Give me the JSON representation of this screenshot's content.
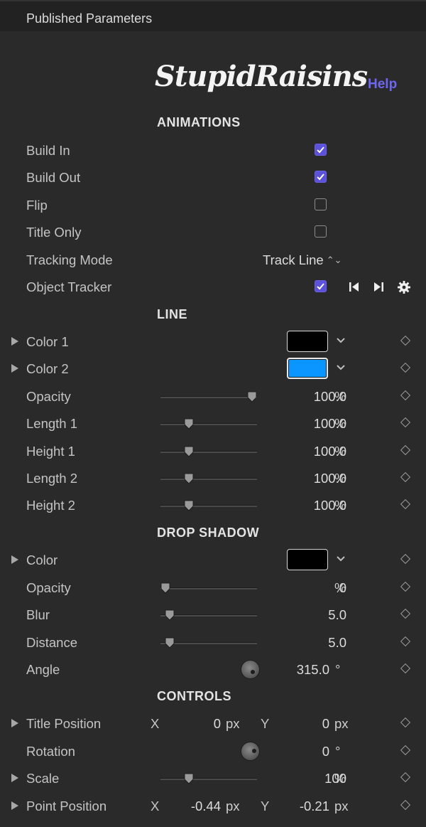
{
  "window": {
    "title": "Published Parameters"
  },
  "header": {
    "logo_text": "StupidRaisins",
    "help_label": "Help"
  },
  "sections": {
    "animations": "ANIMATIONS",
    "line": "LINE",
    "drop_shadow": "DROP SHADOW",
    "controls": "CONTROLS"
  },
  "animations": {
    "build_in": {
      "label": "Build In",
      "checked": true
    },
    "build_out": {
      "label": "Build Out",
      "checked": true
    },
    "flip": {
      "label": "Flip",
      "checked": false
    },
    "title_only": {
      "label": "Title Only",
      "checked": false
    },
    "tracking_mode": {
      "label": "Tracking Mode",
      "value": "Track Line",
      "arrows": "⌃⌄"
    },
    "object_tracker": {
      "label": "Object Tracker",
      "checked": true
    }
  },
  "line": {
    "color1": {
      "label": "Color 1",
      "color": "#000000"
    },
    "color2": {
      "label": "Color 2",
      "color": "#0a95ff"
    },
    "opacity": {
      "label": "Opacity",
      "value": "100.0",
      "unit": "%",
      "slider": 1.0
    },
    "length1": {
      "label": "Length 1",
      "value": "100.0",
      "unit": "%",
      "slider": 0.27
    },
    "height1": {
      "label": "Height 1",
      "value": "100.0",
      "unit": "%",
      "slider": 0.27
    },
    "length2": {
      "label": "Length 2",
      "value": "100.0",
      "unit": "%",
      "slider": 0.27
    },
    "height2": {
      "label": "Height 2",
      "value": "100.0",
      "unit": "%",
      "slider": 0.27
    }
  },
  "drop_shadow": {
    "color": {
      "label": "Color",
      "color": "#000000"
    },
    "opacity": {
      "label": "Opacity",
      "value": "0",
      "unit": "%",
      "slider": 0.0
    },
    "blur": {
      "label": "Blur",
      "value": "5.0",
      "slider": 0.05
    },
    "distance": {
      "label": "Distance",
      "value": "5.0",
      "slider": 0.05
    },
    "angle": {
      "label": "Angle",
      "value": "315.0",
      "unit": "°"
    }
  },
  "controls": {
    "title_position": {
      "label": "Title Position",
      "x_label": "X",
      "x_value": "0",
      "x_unit": "px",
      "y_label": "Y",
      "y_value": "0",
      "y_unit": "px"
    },
    "rotation": {
      "label": "Rotation",
      "value": "0",
      "unit": "°"
    },
    "scale": {
      "label": "Scale",
      "value": "100",
      "unit": "%",
      "slider": 0.27
    },
    "point_position": {
      "label": "Point Position",
      "x_label": "X",
      "x_value": "-0.44",
      "x_unit": "px",
      "y_label": "Y",
      "y_value": "-0.21",
      "y_unit": "px"
    }
  },
  "colors": {
    "accent": "#5b52d9",
    "help": "#6f66f0"
  }
}
